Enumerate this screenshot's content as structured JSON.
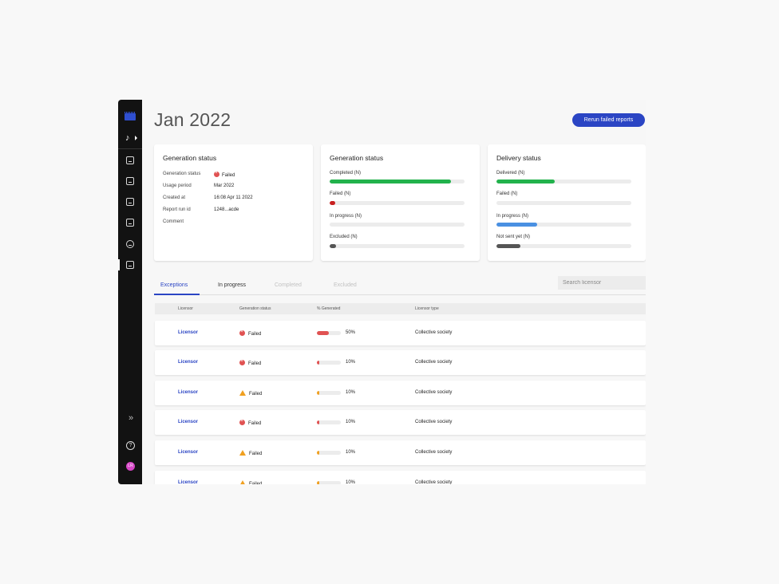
{
  "header": {
    "title": "Jan 2022",
    "rerun_label": "Rerun failed reports"
  },
  "card_generation_details": {
    "title": "Generation status",
    "rows": [
      {
        "key": "Generation status",
        "value": "Failed"
      },
      {
        "key": "Usage period",
        "value": "Mar 2022"
      },
      {
        "key": "Created at",
        "value": "16:08 Apr 11 2022"
      },
      {
        "key": "Report run id",
        "value": "1248...acde"
      },
      {
        "key": "Comment",
        "value": ""
      }
    ]
  },
  "card_generation_status": {
    "title": "Generation status",
    "bars": [
      {
        "label": "Completed (N)",
        "fraction": 0.9,
        "color": "#22b24c"
      },
      {
        "label": "Failed (N)",
        "fraction": 0.04,
        "color": "#c82020"
      },
      {
        "label": "In progress (N)",
        "fraction": 0.0,
        "color": "#4a90e2"
      },
      {
        "label": "Excluded  (N)",
        "fraction": 0.05,
        "color": "#555555"
      }
    ]
  },
  "card_delivery_status": {
    "title": "Delivery status",
    "bars": [
      {
        "label": "Delivered (N)",
        "fraction": 0.43,
        "color": "#22b24c"
      },
      {
        "label": "Failed (N)",
        "fraction": 0.0,
        "color": "#c82020"
      },
      {
        "label": "In progress (N)",
        "fraction": 0.3,
        "color": "#4a90e2"
      },
      {
        "label": "Not sent yet (N)",
        "fraction": 0.18,
        "color": "#555555"
      }
    ]
  },
  "tabs": [
    {
      "label": "Exceptions",
      "state": "active"
    },
    {
      "label": "In progress",
      "state": "normal"
    },
    {
      "label": "Completed",
      "state": "disabled"
    },
    {
      "label": "Excluded",
      "state": "disabled"
    }
  ],
  "search": {
    "placeholder": "Search licensor"
  },
  "table": {
    "headers": [
      "Licensor",
      "Generation status",
      "% Generated",
      "Licensor type"
    ],
    "rows": [
      {
        "licensor": "Licensor",
        "status": "Failed",
        "icon": "error",
        "percent_label": "50%",
        "percent": 0.5,
        "type": "Collective society"
      },
      {
        "licensor": "Licensor",
        "status": "Failed",
        "icon": "error",
        "percent_label": "10%",
        "percent": 0.1,
        "type": "Collective society"
      },
      {
        "licensor": "Licensor",
        "status": "Failed",
        "icon": "warning",
        "percent_label": "10%",
        "percent": 0.1,
        "type": "Collective society"
      },
      {
        "licensor": "Licensor",
        "status": "Failed",
        "icon": "error",
        "percent_label": "10%",
        "percent": 0.1,
        "type": "Collective society"
      },
      {
        "licensor": "Licensor",
        "status": "Failed",
        "icon": "warning",
        "percent_label": "10%",
        "percent": 0.1,
        "type": "Collective society"
      },
      {
        "licensor": "Licensor",
        "status": "Failed",
        "icon": "warning",
        "percent_label": "10%",
        "percent": 0.1,
        "type": "Collective society"
      }
    ]
  },
  "colors": {
    "accent": "#2b45c4",
    "error": "#e05252",
    "warning": "#f0a020",
    "sidebar": "#121212"
  },
  "sidebar": {
    "icons": [
      "logo-icon",
      "music-icon",
      "profile-icon",
      "ticket-icon",
      "image-icon",
      "checklist-icon",
      "play-icon",
      "report-icon",
      "expand-icon",
      "help-icon"
    ],
    "avatar_initials": "LR"
  }
}
